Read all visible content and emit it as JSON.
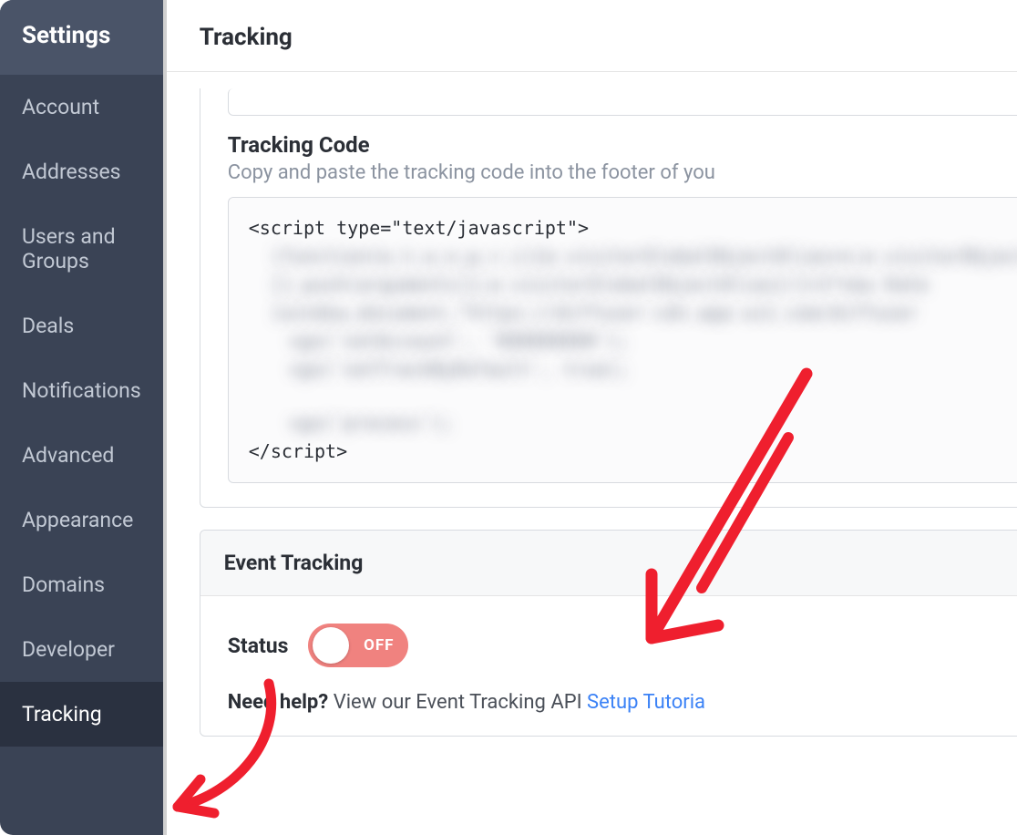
{
  "sidebar": {
    "title": "Settings",
    "items": [
      {
        "label": "Account"
      },
      {
        "label": "Addresses"
      },
      {
        "label": "Users and Groups"
      },
      {
        "label": "Deals"
      },
      {
        "label": "Notifications"
      },
      {
        "label": "Advanced"
      },
      {
        "label": "Appearance"
      },
      {
        "label": "Domains"
      },
      {
        "label": "Developer"
      },
      {
        "label": "Tracking"
      }
    ],
    "active_index": 9
  },
  "main": {
    "title": "Tracking",
    "tracking_code": {
      "heading": "Tracking Code",
      "subheading": "Copy and paste the tracking code into the footer of you",
      "open_line": "<script type=\"text/javascript\">",
      "blurred_lines": [
        "(function(e,t,o,n,p,r,i){e.visitorGlobalObjectAlias=n;e.visitorObject",
        "[].push(arguments)};e.visitorGlobalObjectAlias[r]=1*new Date",
        "(window,document,\"https://diffuser-cdn.app-us1.com/diffuser",
        "vgo('setAccount', '000000000');",
        "vgo('setTrackByDefault', true);",
        "",
        "vgo('process');"
      ],
      "close_line": "</script>"
    },
    "event_tracking": {
      "heading": "Event Tracking",
      "status_label": "Status",
      "toggle_state": "OFF",
      "help_bold": "Need help?",
      "help_text": " View our Event Tracking API ",
      "help_link_text": "Setup Tutoria"
    }
  }
}
